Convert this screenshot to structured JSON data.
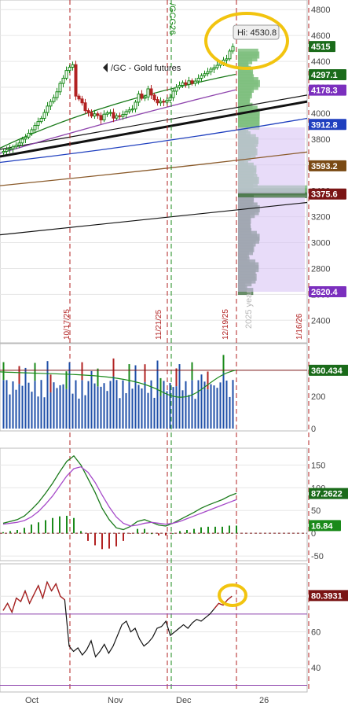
{
  "colors": {
    "up": "#1a8a1a",
    "down": "#b22222",
    "axis_text": "#444444",
    "grid": "#e6e6e6",
    "highlight": "#f2c40f",
    "vline_red": "#b22222",
    "vline_green": "#1a8a1a"
  },
  "price_panel": {
    "symbol_label": "/GC - Gold futures",
    "contract_label": "/GCG26",
    "year_label": "2025 year",
    "high_label": "Hi: 4530.8",
    "ylim": [
      2250,
      4850
    ],
    "y_ticks": [
      "4800",
      "4600",
      "4400",
      "4200",
      "4000",
      "3800",
      "3600",
      "3400",
      "3200",
      "3000",
      "2800",
      "2600",
      "2400"
    ],
    "y_tick_values": [
      4800,
      4600,
      4400,
      4200,
      4000,
      3800,
      3600,
      3400,
      3200,
      3000,
      2800,
      2600,
      2400
    ],
    "date_markers": [
      "10/17/25",
      "11/21/25",
      "12/19/25",
      "1/16/26"
    ],
    "date_marker_bars": [
      22,
      53,
      75,
      98
    ],
    "price_tags": [
      {
        "text": "4515",
        "value": 4515,
        "bg": "#1a6b1a"
      },
      {
        "text": "4297.1",
        "value": 4297.1,
        "bg": "#1a6b1a"
      },
      {
        "text": "4178.3",
        "value": 4178.3,
        "bg": "#7b2fbe"
      },
      {
        "text": "3912.8",
        "value": 3912.8,
        "bg": "#1f3fbf"
      },
      {
        "text": "3593.2",
        "value": 3593.2,
        "bg": "#7a4a14"
      },
      {
        "text": "3375.6",
        "value": 3375.6,
        "bg": "#7a1414"
      },
      {
        "text": "2620.4",
        "value": 2620.4,
        "bg": "#7b2fbe"
      }
    ],
    "closes": [
      3705,
      3718,
      3725,
      3740,
      3752,
      3770,
      3800,
      3815,
      3845,
      3872,
      3905,
      3935,
      3960,
      4005,
      4055,
      4090,
      4120,
      4165,
      4230,
      4270,
      4330,
      4355,
      4375,
      4132,
      4110,
      4080,
      4020,
      4005,
      3978,
      3995,
      3982,
      3948,
      3992,
      4002,
      4005,
      3962,
      3980,
      3975,
      3990,
      4012,
      4025,
      4032,
      4085,
      4148,
      4115,
      4125,
      4188,
      4140,
      4105,
      4080,
      4092,
      4085,
      4100,
      4120,
      4170,
      4200,
      4215,
      4235,
      4222,
      4250,
      4230,
      4248,
      4270,
      4290,
      4305,
      4320,
      4340,
      4352,
      4370,
      4390,
      4410,
      4420,
      4480,
      4515
    ]
  },
  "volume_panel": {
    "value_tag": "360.434",
    "y_ticks": [
      "200",
      "0"
    ],
    "ylim": [
      0,
      500
    ]
  },
  "macd_panel": {
    "y_ticks": [
      "150",
      "100",
      "50",
      "0",
      "-50"
    ],
    "ylim": [
      -55,
      180
    ],
    "value_tags": [
      {
        "text": "87.2622",
        "value": 87.2622
      },
      {
        "text": "16.84",
        "value": 16.84
      }
    ]
  },
  "rsi_panel": {
    "y_ticks": [
      "80",
      "60",
      "40"
    ],
    "ylim": [
      28,
      96
    ],
    "value_tag": "80.3931",
    "value": 80.3931,
    "reference_level": 70,
    "values": [
      72,
      76,
      71,
      79,
      77,
      83,
      76,
      81,
      86,
      79,
      88,
      83,
      87,
      80,
      78,
      52,
      49,
      51,
      47,
      50,
      55,
      46,
      49,
      53,
      48,
      52,
      58,
      64,
      66,
      60,
      62,
      56,
      52,
      54,
      57,
      62,
      63,
      66,
      58,
      60,
      62,
      64,
      62,
      65,
      67,
      66,
      68,
      70,
      73,
      76,
      75,
      78,
      80
    ]
  },
  "x_axis": {
    "labels": [
      "Oct",
      "Nov",
      "Dec",
      "26"
    ]
  },
  "chart_data": [
    {
      "type": "line",
      "title": "/GC - Gold futures",
      "x": [
        "Oct",
        "Nov",
        "Dec",
        "26"
      ],
      "series": [
        {
          "name": "/GC - Gold futures",
          "values": [
            3705,
            4002,
            4215,
            4515
          ]
        }
      ],
      "ylim": [
        2250,
        4850
      ],
      "annotations": [
        "Hi: 4530.8",
        "10/17/25",
        "11/21/25",
        "12/19/25",
        "1/16/26",
        "2025 year",
        "/GCG26"
      ]
    },
    {
      "type": "bar",
      "title": "",
      "ylim": [
        0,
        500
      ],
      "annotations": [
        "360.434"
      ]
    },
    {
      "type": "line",
      "title": "",
      "ylim": [
        -55,
        180
      ],
      "annotations": [
        "87.2622",
        "16.84"
      ]
    },
    {
      "type": "line",
      "title": "",
      "ylim": [
        28,
        96
      ],
      "annotations": [
        "80.3931"
      ]
    }
  ]
}
